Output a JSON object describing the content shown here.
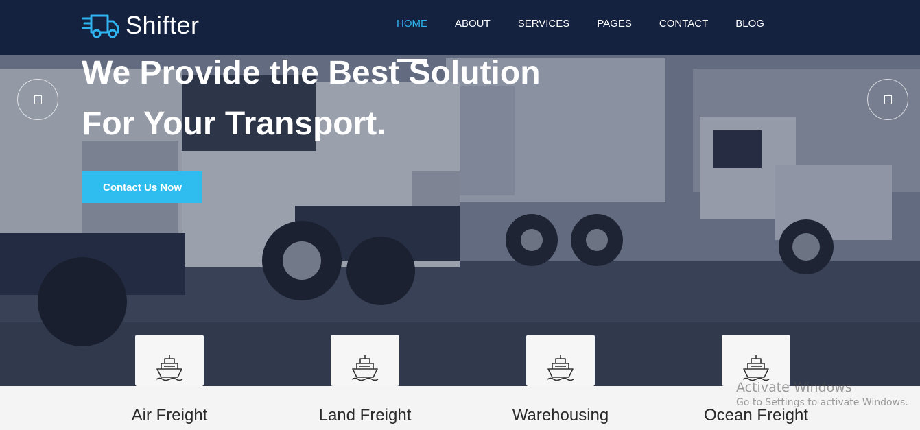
{
  "brand": {
    "name": "Shifter",
    "logo_icon": "delivery-truck-icon"
  },
  "nav": {
    "items": [
      {
        "label": "HOME",
        "active": true
      },
      {
        "label": "ABOUT",
        "active": false
      },
      {
        "label": "SERVICES",
        "active": false
      },
      {
        "label": "PAGES",
        "active": false
      },
      {
        "label": "CONTACT",
        "active": false
      },
      {
        "label": "BLOG",
        "active": false
      }
    ]
  },
  "hero": {
    "title_line1": "We Provide the Best Solution",
    "title_line2": "For Your Transport.",
    "cta_label": "Contact Us Now",
    "prev_icon": "arrow-left-icon",
    "next_icon": "arrow-right-icon"
  },
  "services": [
    {
      "label": "Air Freight",
      "icon": "ship-icon"
    },
    {
      "label": "Land Freight",
      "icon": "ship-icon"
    },
    {
      "label": "Warehousing",
      "icon": "ship-icon"
    },
    {
      "label": "Ocean Freight",
      "icon": "ship-icon"
    }
  ],
  "watermark": {
    "line1": "Activate Windows",
    "line2": "Go to Settings to activate Windows."
  },
  "colors": {
    "nav_bg": "#14213f",
    "accent": "#2fbdf0",
    "active_nav": "#2fb4f0"
  }
}
